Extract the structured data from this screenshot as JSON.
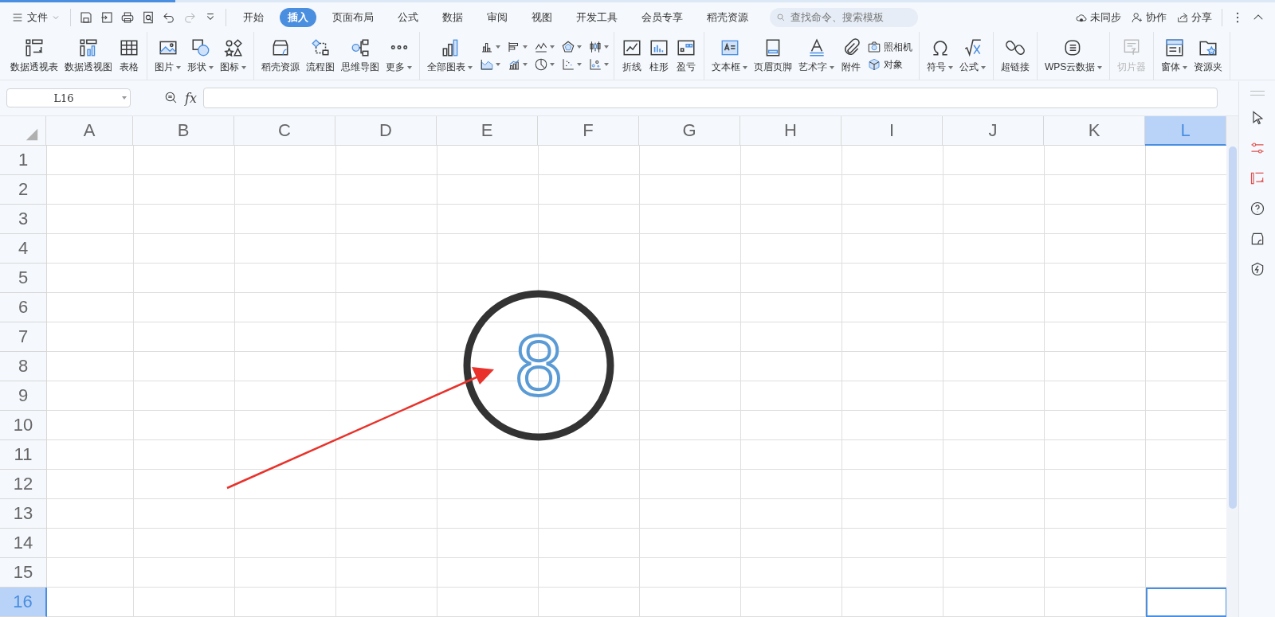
{
  "menu": {
    "label": "文件"
  },
  "tabs": [
    {
      "label": "开始",
      "selected": false
    },
    {
      "label": "插入",
      "selected": true
    },
    {
      "label": "页面布局",
      "selected": false
    },
    {
      "label": "公式",
      "selected": false
    },
    {
      "label": "数据",
      "selected": false
    },
    {
      "label": "审阅",
      "selected": false
    },
    {
      "label": "视图",
      "selected": false
    },
    {
      "label": "开发工具",
      "selected": false
    },
    {
      "label": "会员专享",
      "selected": false
    },
    {
      "label": "稻壳资源",
      "selected": false
    }
  ],
  "search": {
    "placeholder": "查找命令、搜索模板"
  },
  "actions": [
    {
      "label": "未同步"
    },
    {
      "label": "协作"
    },
    {
      "label": "分享"
    }
  ],
  "ribbon": {
    "groups": [
      {
        "items": [
          {
            "kind": "large",
            "label": "数据透视表",
            "dropdown": false,
            "disabled": false
          },
          {
            "kind": "large",
            "label": "数据透视图",
            "dropdown": false,
            "disabled": false
          },
          {
            "kind": "large",
            "label": "表格",
            "dropdown": false,
            "disabled": false
          }
        ]
      },
      {
        "items": [
          {
            "kind": "large",
            "label": "图片",
            "dropdown": true,
            "disabled": false
          },
          {
            "kind": "large",
            "label": "形状",
            "dropdown": true,
            "disabled": false
          },
          {
            "kind": "large",
            "label": "图标",
            "dropdown": true,
            "disabled": false
          }
        ]
      },
      {
        "items": [
          {
            "kind": "large",
            "label": "稻壳资源",
            "dropdown": false,
            "disabled": false
          },
          {
            "kind": "large",
            "label": "流程图",
            "dropdown": false,
            "disabled": false
          },
          {
            "kind": "large",
            "label": "思维导图",
            "dropdown": false,
            "disabled": false
          },
          {
            "kind": "large",
            "label": "更多",
            "dropdown": true,
            "disabled": false
          }
        ]
      },
      {
        "items": [
          {
            "kind": "large",
            "label": "全部图表",
            "dropdown": true,
            "disabled": false
          },
          {
            "kind": "chart-grid",
            "cells": [
              {
                "dropdown": true
              },
              {
                "dropdown": true
              },
              {
                "dropdown": true
              },
              {
                "dropdown": true
              },
              {
                "dropdown": true
              },
              {
                "dropdown": true
              },
              {
                "dropdown": true
              },
              {
                "dropdown": true
              },
              {
                "dropdown": true
              },
              {
                "dropdown": true
              }
            ]
          }
        ]
      },
      {
        "items": [
          {
            "kind": "large",
            "label": "折线",
            "dropdown": false,
            "disabled": false
          },
          {
            "kind": "large",
            "label": "柱形",
            "dropdown": false,
            "disabled": false
          },
          {
            "kind": "large",
            "label": "盈亏",
            "dropdown": false,
            "disabled": false
          }
        ]
      },
      {
        "items": [
          {
            "kind": "large",
            "label": "文本框",
            "dropdown": true,
            "disabled": false
          },
          {
            "kind": "large",
            "label": "页眉页脚",
            "dropdown": false,
            "disabled": false
          },
          {
            "kind": "large",
            "label": "艺术字",
            "dropdown": true,
            "disabled": false
          },
          {
            "kind": "large",
            "label": "附件",
            "dropdown": false,
            "disabled": false
          },
          {
            "kind": "stack",
            "items": [
              {
                "label": "照相机"
              },
              {
                "label": "对象"
              }
            ]
          }
        ]
      },
      {
        "items": [
          {
            "kind": "large",
            "label": "符号",
            "dropdown": true,
            "disabled": false
          },
          {
            "kind": "large",
            "label": "公式",
            "dropdown": true,
            "disabled": false
          }
        ]
      },
      {
        "items": [
          {
            "kind": "large",
            "label": "超链接",
            "dropdown": false,
            "disabled": false
          }
        ]
      },
      {
        "items": [
          {
            "kind": "large",
            "label": "WPS云数据",
            "dropdown": true,
            "disabled": false
          }
        ]
      },
      {
        "items": [
          {
            "kind": "large",
            "label": "切片器",
            "dropdown": false,
            "disabled": true
          }
        ]
      },
      {
        "items": [
          {
            "kind": "large",
            "label": "窗体",
            "dropdown": true,
            "disabled": false
          },
          {
            "kind": "large",
            "label": "资源夹",
            "dropdown": false,
            "disabled": false
          }
        ]
      }
    ]
  },
  "formula_bar": {
    "name_box": "L16",
    "fx": "fx"
  },
  "sheet": {
    "columns": [
      {
        "label": "A",
        "selected": false
      },
      {
        "label": "B",
        "selected": false
      },
      {
        "label": "C",
        "selected": false
      },
      {
        "label": "D",
        "selected": false
      },
      {
        "label": "E",
        "selected": false
      },
      {
        "label": "F",
        "selected": false
      },
      {
        "label": "G",
        "selected": false
      },
      {
        "label": "H",
        "selected": false
      },
      {
        "label": "I",
        "selected": false
      },
      {
        "label": "J",
        "selected": false
      },
      {
        "label": "K",
        "selected": false
      },
      {
        "label": "L",
        "selected": true
      }
    ],
    "rows": [
      {
        "label": "1",
        "selected": false
      },
      {
        "label": "2",
        "selected": false
      },
      {
        "label": "3",
        "selected": false
      },
      {
        "label": "4",
        "selected": false
      },
      {
        "label": "5",
        "selected": false
      },
      {
        "label": "6",
        "selected": false
      },
      {
        "label": "7",
        "selected": false
      },
      {
        "label": "8",
        "selected": false
      },
      {
        "label": "9",
        "selected": false
      },
      {
        "label": "10",
        "selected": false
      },
      {
        "label": "11",
        "selected": false
      },
      {
        "label": "12",
        "selected": false
      },
      {
        "label": "13",
        "selected": false
      },
      {
        "label": "14",
        "selected": false
      },
      {
        "label": "15",
        "selected": false
      },
      {
        "label": "16",
        "selected": true
      }
    ]
  },
  "annotation": {
    "number": "8"
  }
}
